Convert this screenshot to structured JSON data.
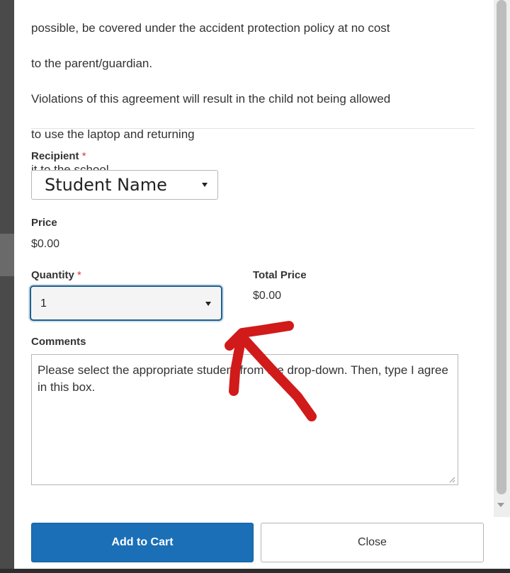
{
  "policy": {
    "lines": [
      " possible, be covered under the accident protection policy at no cost",
      "to the parent/guardian.",
      " Violations of this agreement will result in the child not being allowed",
      "to use the laptop and returning",
      " it to the school."
    ]
  },
  "recipient": {
    "label": "Recipient",
    "required_mark": "*",
    "selected": "Student Name"
  },
  "price": {
    "label": "Price",
    "value": "$0.00"
  },
  "quantity": {
    "label": "Quantity",
    "required_mark": "*",
    "selected": "1"
  },
  "total_price": {
    "label": "Total Price",
    "value": "$0.00"
  },
  "comments": {
    "label": "Comments",
    "value": "Please select the appropriate student from the drop-down. Then, type I agree in this box."
  },
  "buttons": {
    "add_to_cart": "Add to Cart",
    "close": "Close"
  },
  "colors": {
    "primary": "#1a6fb7",
    "required": "#d23b3b",
    "annotation": "#d11a1a"
  },
  "icons": {
    "dropdown": "chevron-down-icon",
    "annotation": "arrow-annotation-icon"
  }
}
